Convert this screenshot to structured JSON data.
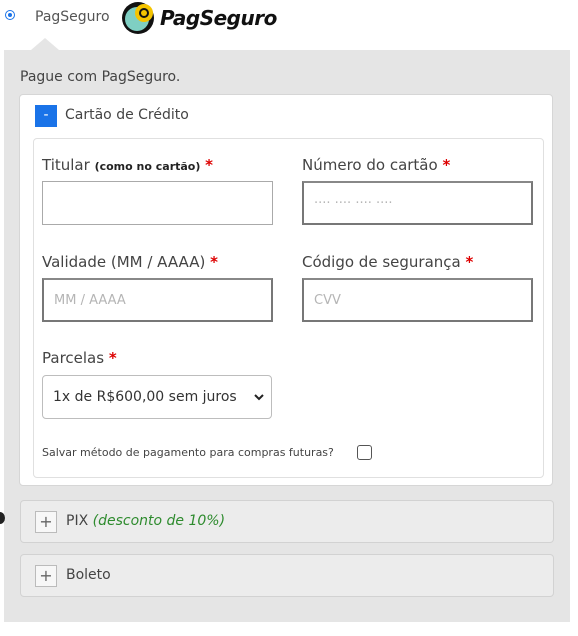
{
  "gateway": {
    "label": "PagSeguro",
    "logo_text": "PagSeguro"
  },
  "panel": {
    "intro": "Pague com PagSeguro."
  },
  "card_section": {
    "toggle": "-",
    "title": "Cartão de Crédito",
    "fields": {
      "holder": {
        "label": "Titular",
        "hint": "(como no cartão)",
        "required": "*",
        "value": "",
        "placeholder": ""
      },
      "number": {
        "label": "Número do cartão",
        "required": "*",
        "value": "",
        "placeholder": "···· ···· ···· ····"
      },
      "expiry": {
        "label": "Validade (MM / AAAA)",
        "required": "*",
        "value": "",
        "placeholder": "MM / AAAA"
      },
      "cvv": {
        "label": "Código de segurança",
        "required": "*",
        "value": "",
        "placeholder": "CVV"
      },
      "installments": {
        "label": "Parcelas",
        "required": "*",
        "selected": "1x de R$600,00 sem juros"
      }
    },
    "save_method": "Salvar método de pagamento para compras futuras?"
  },
  "pix": {
    "toggle": "+",
    "title": "PIX",
    "discount": "(desconto de 10%)"
  },
  "boleto": {
    "toggle": "+",
    "title": "Boleto"
  },
  "colors": {
    "accent": "#1a73e8",
    "required": "#dd0000",
    "discount": "#2e8b2e",
    "panel_bg": "#e5e5e5"
  }
}
